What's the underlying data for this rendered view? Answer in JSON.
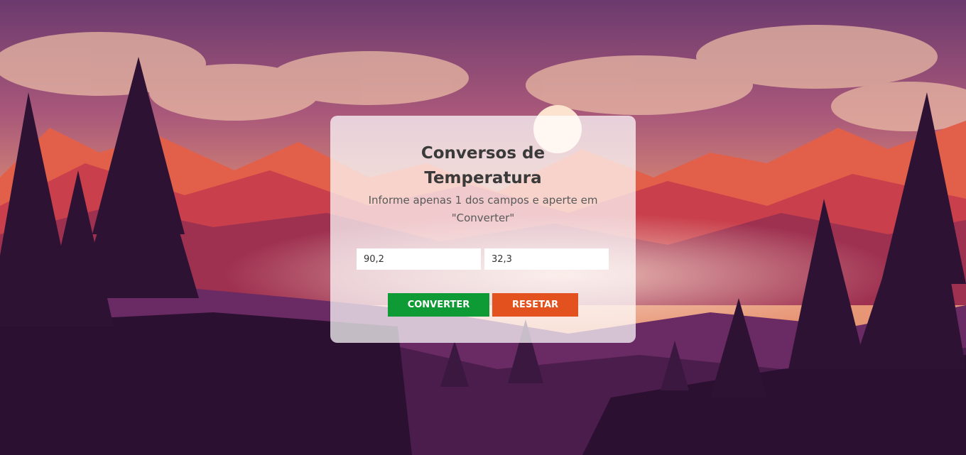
{
  "card": {
    "title_line1": "Conversos de",
    "title_line2": "Temperatura",
    "subtitle_line1": "Informe apenas 1 dos campos e aperte em",
    "subtitle_line2": "\"Converter\""
  },
  "inputs": {
    "celsius_value": "90,2",
    "fahrenheit_value": "32,3"
  },
  "buttons": {
    "convert_label": "CONVERTER",
    "reset_label": "RESETAR"
  },
  "colors": {
    "convert_button": "#0e9a34",
    "reset_button": "#e3521e",
    "title_text": "#3a3a3a"
  }
}
